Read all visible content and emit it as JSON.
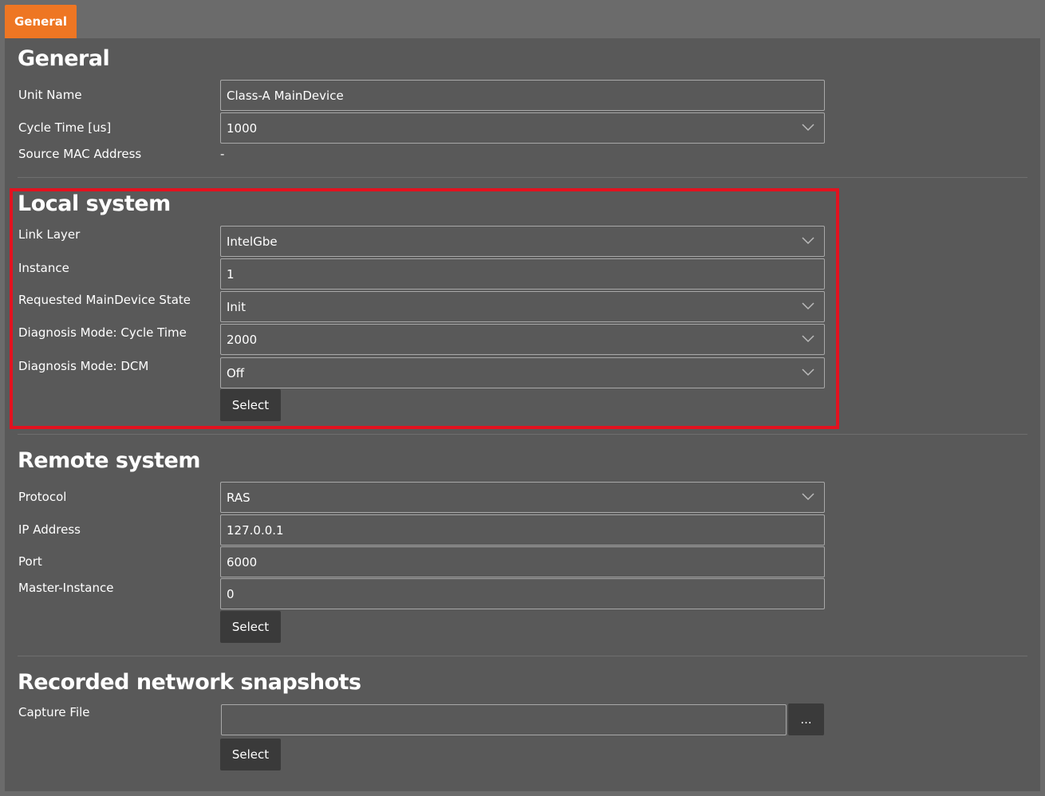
{
  "tab": {
    "label": "General"
  },
  "general": {
    "title": "General",
    "unit_name": {
      "label": "Unit Name",
      "value": "Class-A MainDevice"
    },
    "cycle_time": {
      "label": "Cycle Time [us]",
      "value": "1000"
    },
    "source_mac": {
      "label": "Source MAC Address",
      "value": "-"
    }
  },
  "local": {
    "title": "Local system",
    "link_layer": {
      "label": "Link Layer",
      "value": "IntelGbe"
    },
    "instance": {
      "label": "Instance",
      "value": "1"
    },
    "requested_state": {
      "label": "Requested MainDevice State",
      "value": "Init"
    },
    "diag_cycle": {
      "label": "Diagnosis Mode: Cycle Time",
      "value": "2000"
    },
    "diag_dcm": {
      "label": "Diagnosis Mode: DCM",
      "value": "Off"
    },
    "select_label": "Select"
  },
  "remote": {
    "title": "Remote system",
    "protocol": {
      "label": "Protocol",
      "value": "RAS"
    },
    "ip": {
      "label": "IP Address",
      "value": "127.0.0.1"
    },
    "port": {
      "label": "Port",
      "value": "6000"
    },
    "master_instance": {
      "label": "Master-Instance",
      "value": "0"
    },
    "select_label": "Select"
  },
  "snapshots": {
    "title": "Recorded network snapshots",
    "capture_file": {
      "label": "Capture File",
      "value": ""
    },
    "browse_label": "...",
    "select_label": "Select"
  },
  "colors": {
    "accent": "#ee7623",
    "highlight": "#e3121f",
    "panel": "#595959"
  }
}
